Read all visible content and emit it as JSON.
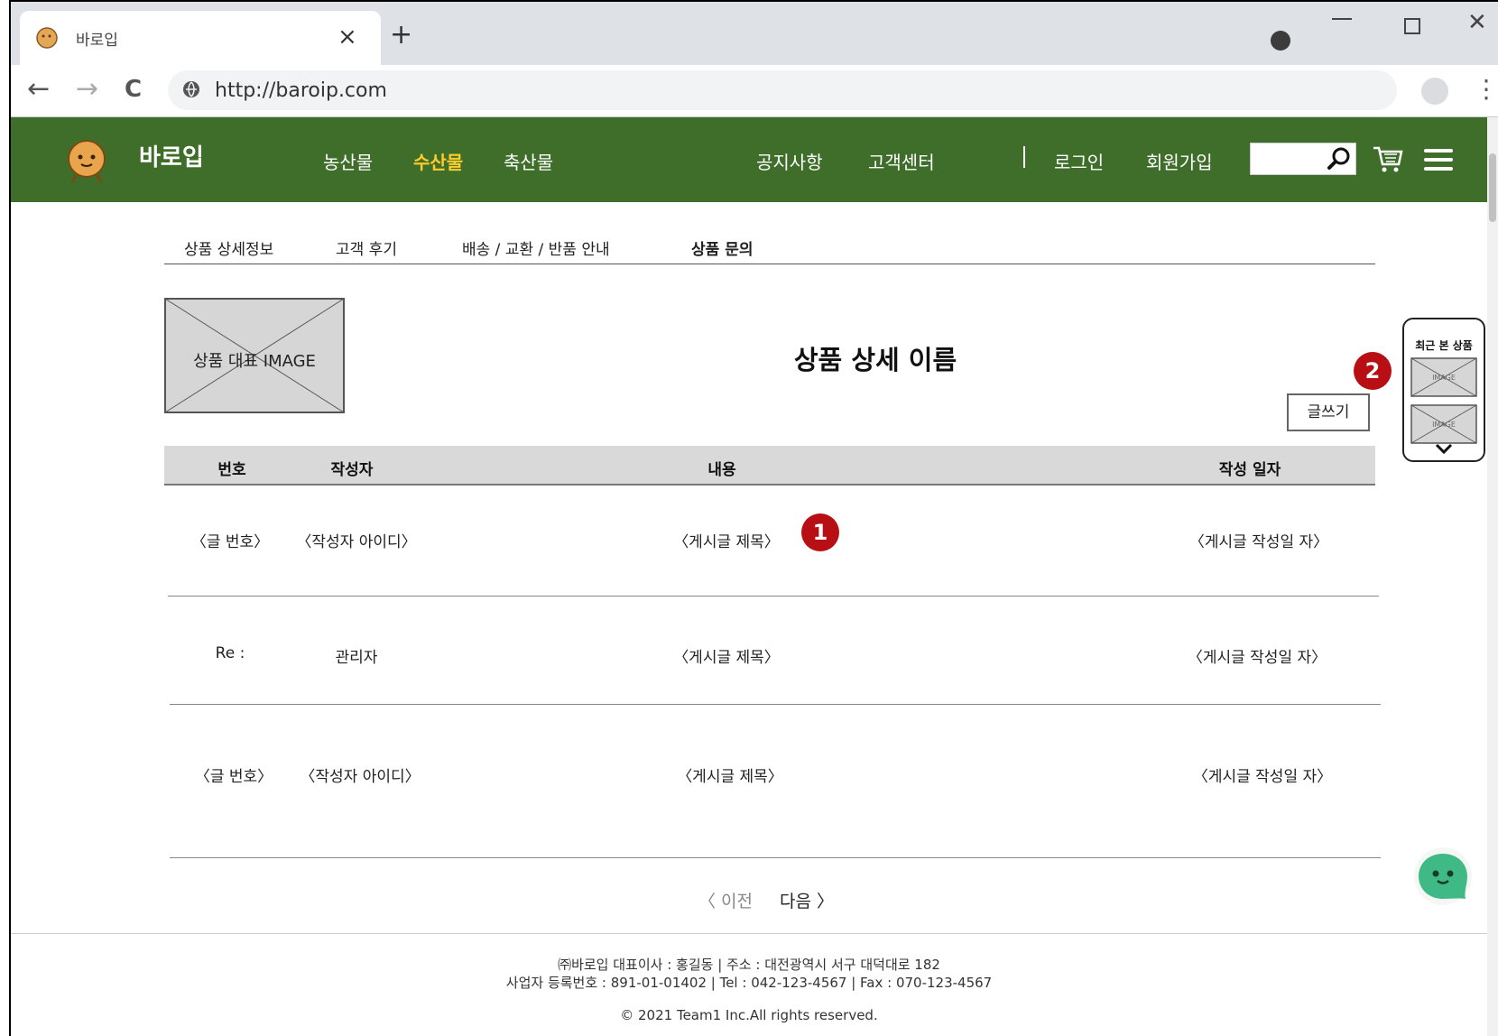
{
  "browser": {
    "tab_title": "바로입",
    "tab_close": "×",
    "new_tab": "+",
    "url": "http://baroip.com",
    "back": "←",
    "forward": "→",
    "reload": "C",
    "menu": "⋮",
    "close": "✕"
  },
  "header": {
    "brand": "바로입",
    "nav": [
      "농산물",
      "수산물",
      "축산물"
    ],
    "links": [
      "공지사항",
      "고객센터"
    ],
    "login": "로그인",
    "signup": "회원가입",
    "search_placeholder": "",
    "colors": {
      "header_bg": "#3f6e2b",
      "active_nav": "#ffcc2b"
    }
  },
  "subtabs": [
    "상품 상세정보",
    "고객 후기",
    "배송 / 교환 / 반품 안내",
    "상품 문의"
  ],
  "product": {
    "image_label": "상품 대표 IMAGE",
    "title": "상품 상세 이름"
  },
  "write_button": "글쓰기",
  "table": {
    "headers": [
      "번호",
      "작성자",
      "내용",
      "작성 일자"
    ],
    "rows": [
      {
        "no": "〈글 번호〉",
        "author": "〈작성자 아이디〉",
        "content": "〈게시글 제목〉",
        "date": "〈게시글 작성일 자〉"
      },
      {
        "no": "Re :",
        "author": "관리자",
        "content": "〈게시글 제목〉",
        "date": "〈게시글 작성일 자〉"
      },
      {
        "no": "〈글 번호〉",
        "author": "〈작성자 아이디〉",
        "content": "〈게시글 제목〉",
        "date": "〈게시글 작성일 자〉"
      }
    ]
  },
  "badges": [
    "1",
    "2"
  ],
  "recent": {
    "title": "최근 본 상품",
    "items": [
      "IMAGE",
      "IMAGE"
    ]
  },
  "pager": {
    "prev": "〈 이전",
    "next": "다음 〉"
  },
  "footer": {
    "line1": "㈜바로입 대표이사 : 홍길동 | 주소 : 대전광역시 서구 대덕대로 182",
    "line2": "사업자 등록번호 : 891-01-01402 | Tel : 042-123-4567 | Fax : 070-123-4567",
    "copyright": "© 2021 Team1 Inc.All rights reserved."
  }
}
